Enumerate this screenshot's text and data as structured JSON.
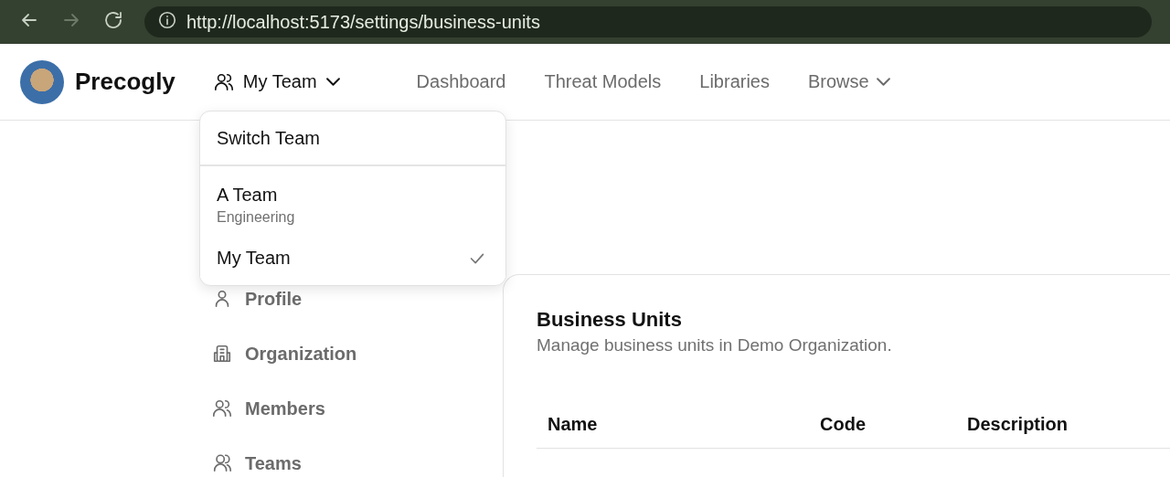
{
  "browser": {
    "url": "http://localhost:5173/settings/business-units"
  },
  "header": {
    "brand": "Precogly",
    "team_button": {
      "label": "My Team",
      "expanded": true
    },
    "nav": [
      {
        "label": "Dashboard",
        "kind": "link"
      },
      {
        "label": "Threat Models",
        "kind": "link"
      },
      {
        "label": "Libraries",
        "kind": "link"
      },
      {
        "label": "Browse",
        "kind": "menu"
      }
    ]
  },
  "team_menu": {
    "title": "Switch Team",
    "teams": [
      {
        "name": "A Team",
        "subtitle": "Engineering",
        "selected": false
      },
      {
        "name": "My Team",
        "selected": true
      }
    ]
  },
  "sidebar": {
    "items": [
      {
        "label": "Profile",
        "kind": "user"
      },
      {
        "label": "Organization",
        "kind": "building"
      },
      {
        "label": "Members",
        "kind": "users"
      },
      {
        "label": "Teams",
        "kind": "team"
      }
    ]
  },
  "card": {
    "title": "Business Units",
    "subtitle": "Manage business units in Demo Organization.",
    "columns": [
      "Name",
      "Code",
      "Description"
    ]
  }
}
